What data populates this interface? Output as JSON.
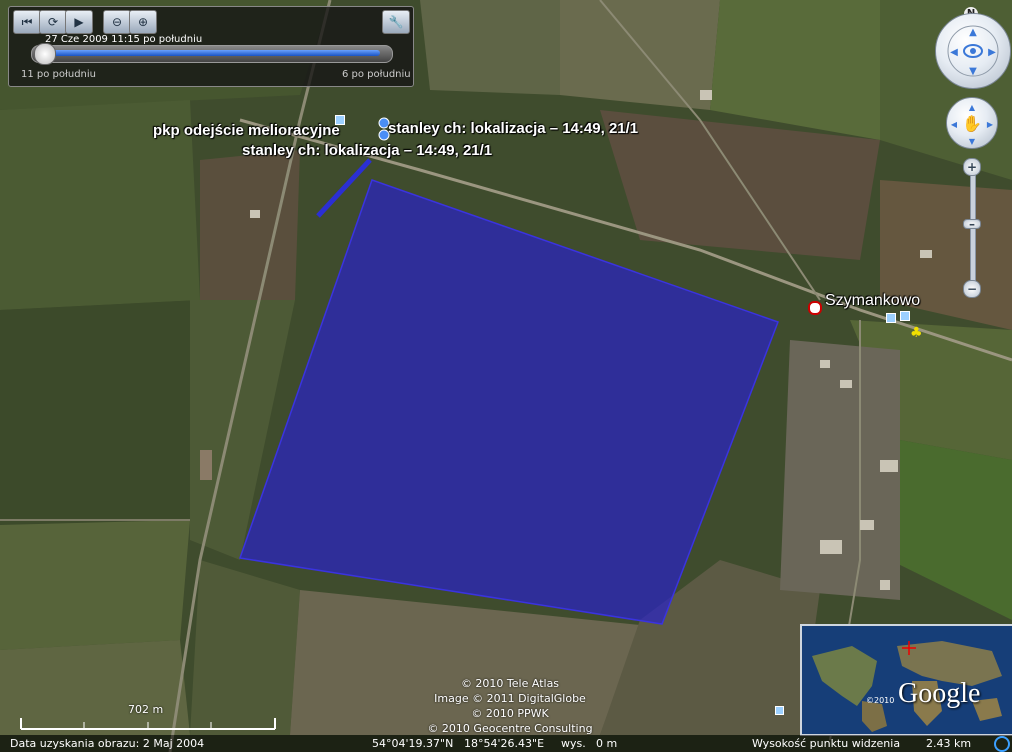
{
  "time_slider": {
    "current": "27 Cze 2009   11:15 po południu",
    "start_label": "11 po południu",
    "end_label": "6 po południu"
  },
  "compass": {
    "north": "N"
  },
  "labels": {
    "place_name": "Szymankowo",
    "placemark_1": "pkp odejście melioracyjne",
    "placemark_2": "stanley ch: lokalizacja – 14:49, 21/1",
    "placemark_3": "stanley ch: lokalizacja – 14:49, 21/1"
  },
  "copyright": {
    "line1": "© 2010 Tele Atlas",
    "line2": "Image © 2011 DigitalGlobe",
    "line3": "© 2010 PPWK",
    "line4": "© 2010 Geocentre Consulting"
  },
  "scale": {
    "label": "702 m"
  },
  "status": {
    "image_date": "Data uzyskania obrazu:  2 Maj 2004",
    "lat": "54°04'19.37\"N",
    "lon": "18°54'26.43\"E",
    "elev_label": "wys.",
    "elev_value": "0 m",
    "eye_label": "Wysokość punktu widzenia",
    "eye_value": "2.43 km"
  },
  "overview": {
    "year": "©2010",
    "logo": "Google"
  },
  "colors": {
    "polygon": "#2a22c8",
    "polygon_edge": "#3a33e0"
  }
}
